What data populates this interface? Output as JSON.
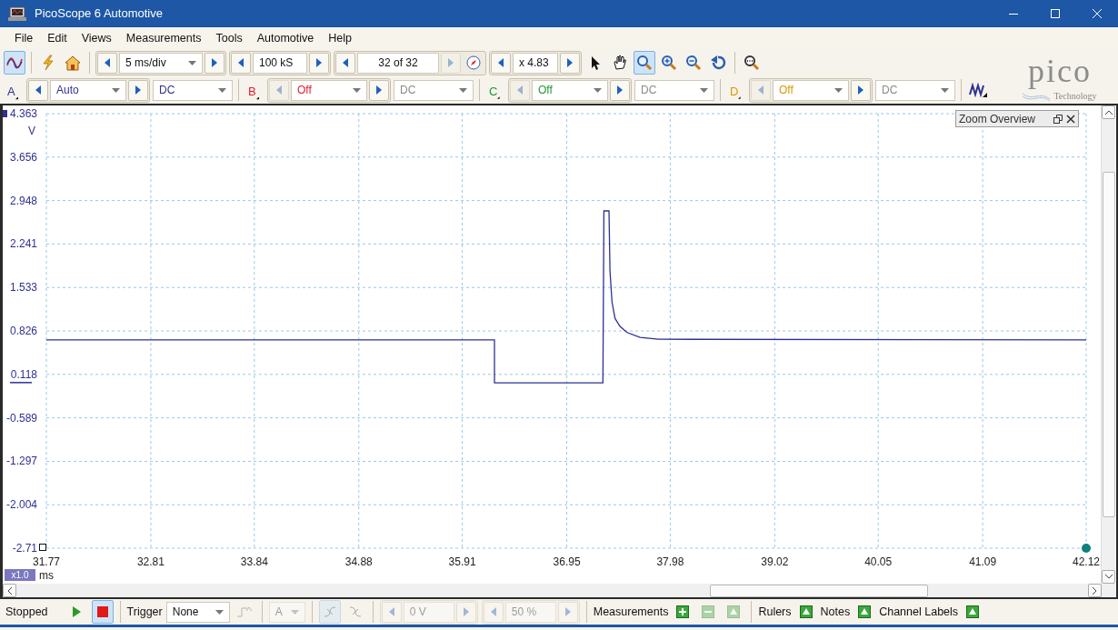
{
  "window": {
    "title": "PicoScope 6 Automotive"
  },
  "menu": [
    {
      "label": "File"
    },
    {
      "label": "Edit"
    },
    {
      "label": "Views"
    },
    {
      "label": "Measurements"
    },
    {
      "label": "Tools"
    },
    {
      "label": "Automotive"
    },
    {
      "label": "Help"
    }
  ],
  "toolbar": {
    "scope_mode_selected": true,
    "timebase": "5 ms/div",
    "samples": "100 kS",
    "buffer": "32 of 32",
    "zoom_factor": "x 4.83",
    "tools": [
      {
        "kind": "pointer",
        "selected": false
      },
      {
        "kind": "hand",
        "selected": false
      },
      {
        "kind": "zoom",
        "selected": true
      },
      {
        "kind": "zoom-in",
        "selected": false
      },
      {
        "kind": "zoom-out",
        "selected": false
      },
      {
        "kind": "undo",
        "selected": false
      },
      {
        "kind": "overview",
        "selected": false
      }
    ]
  },
  "logo": {
    "name": "pico",
    "tagline": "Technology"
  },
  "channels": [
    {
      "label": "A",
      "color": "#2e3192",
      "range": "Auto",
      "coupling": "DC",
      "enabled": true
    },
    {
      "label": "B",
      "color": "#e0202a",
      "range": "Off",
      "coupling": "DC",
      "enabled": false
    },
    {
      "label": "C",
      "color": "#1f9a2e",
      "range": "Off",
      "coupling": "DC",
      "enabled": false
    },
    {
      "label": "D",
      "color": "#d99a00",
      "range": "Off",
      "coupling": "DC",
      "enabled": false
    }
  ],
  "plot": {
    "unit": "V",
    "time_unit": "ms",
    "zoom_badge": "x1.0",
    "overview": {
      "title": "Zoom Overview"
    },
    "chart_data": {
      "type": "line",
      "grid": true,
      "xlim": [
        31.77,
        42.12
      ],
      "ylim": [
        -2.711,
        4.363
      ],
      "xticks": [
        31.77,
        32.81,
        33.84,
        34.88,
        35.91,
        36.95,
        37.98,
        39.02,
        40.05,
        41.09,
        42.12
      ],
      "yticks": [
        4.363,
        3.656,
        2.948,
        2.241,
        1.533,
        0.826,
        0.118,
        -0.589,
        -1.297,
        -2.004,
        {
          "value": -2.711,
          "label": "-2.71"
        }
      ],
      "x": [
        31.77,
        36.23,
        36.23,
        37.31,
        37.32,
        37.37,
        37.38,
        37.4,
        37.43,
        37.48,
        37.55,
        37.68,
        37.86,
        42.12
      ],
      "series": [
        {
          "color": "#2e3192",
          "values": [
            0.68,
            0.68,
            -0.02,
            -0.02,
            2.78,
            2.78,
            1.8,
            1.3,
            1.03,
            0.9,
            0.8,
            0.72,
            0.69,
            0.68
          ]
        }
      ]
    }
  },
  "status": {
    "state": "Stopped",
    "running": false
  },
  "trigger": {
    "label": "Trigger",
    "mode": "None",
    "channel": "A",
    "threshold": "0 V",
    "pretrigger": "50 %",
    "controls_disabled": true
  },
  "measurements": {
    "label": "Measurements",
    "actions": [
      {
        "kind": "add",
        "disabled": false
      },
      {
        "kind": "remove",
        "disabled": true
      },
      {
        "kind": "edit",
        "disabled": true
      }
    ]
  },
  "toggles": [
    {
      "label": "Rulers"
    },
    {
      "label": "Notes"
    },
    {
      "label": "Channel Labels"
    }
  ]
}
